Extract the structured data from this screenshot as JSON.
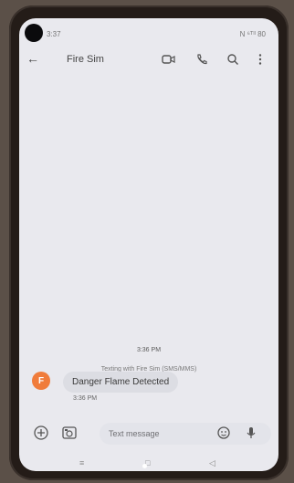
{
  "status_bar": {
    "time": "3:37",
    "status_right": "N ⁶ᵀˡˡ 80"
  },
  "app_bar": {
    "title": "Fire Sim",
    "back_icon": "arrow-left",
    "actions": [
      "video-call-icon",
      "phone-icon",
      "search-icon",
      "more-vertical-icon"
    ]
  },
  "thread": {
    "timestamp": "3:36 PM",
    "subtitle": "Texting with Fire Sim (SMS/MMS)",
    "messages": [
      {
        "avatar_letter": "F",
        "text": "Danger Flame Detected",
        "time": "3:36 PM"
      }
    ]
  },
  "composer": {
    "placeholder": "Text message",
    "left_icons": [
      "add-icon",
      "gallery-icon"
    ],
    "right_icons": [
      "emoji-icon",
      "mic-icon"
    ]
  },
  "colors": {
    "avatar": "#f07c3b",
    "bubble": "#dcdde3",
    "screen_bg": "#e9e9ee"
  }
}
